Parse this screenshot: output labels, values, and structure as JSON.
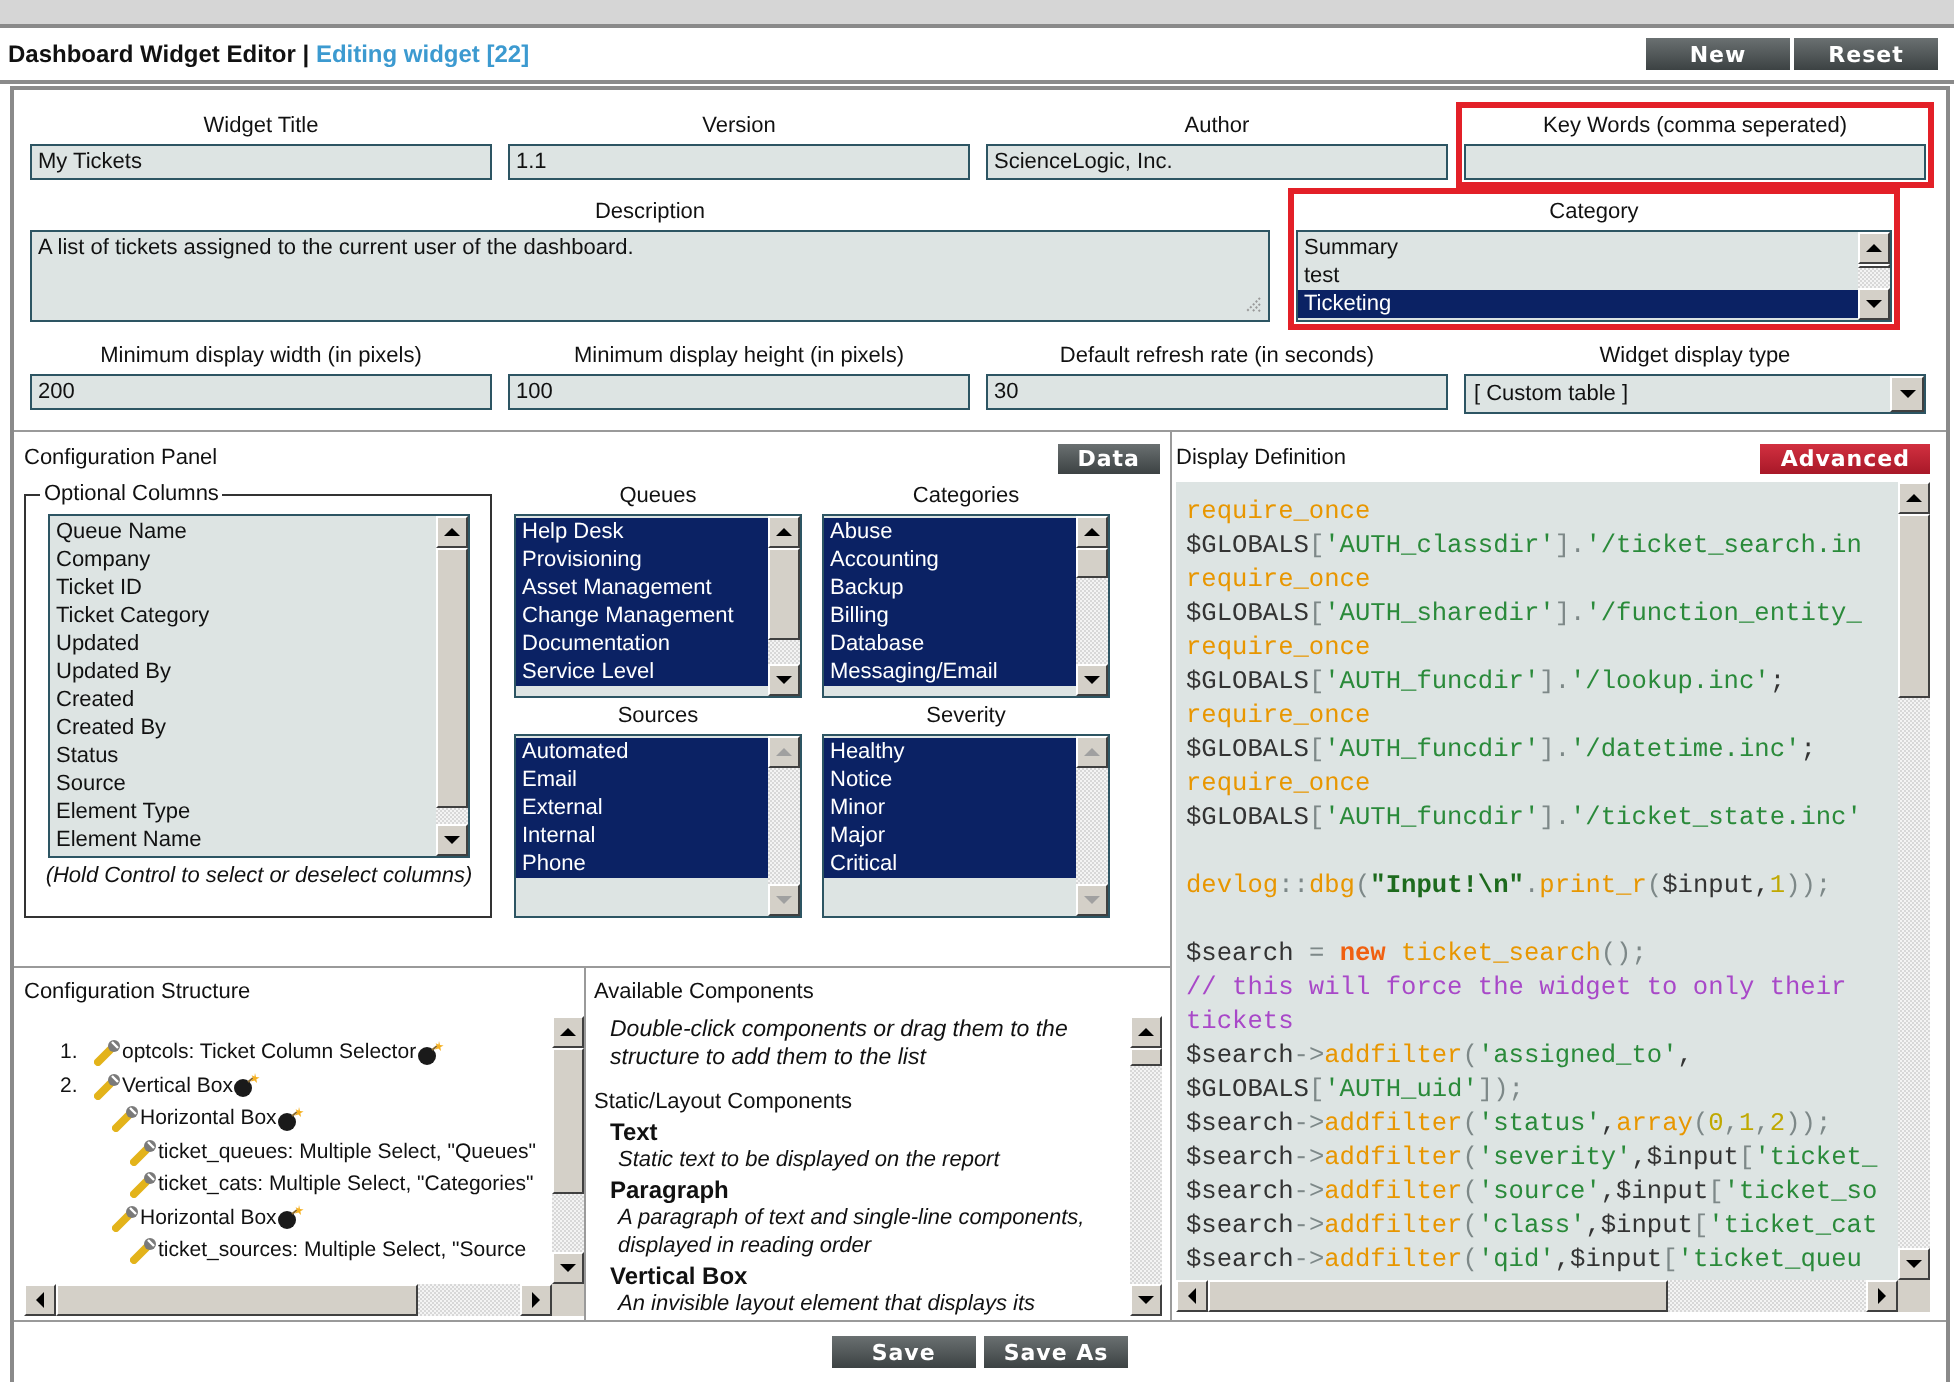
{
  "header": {
    "title": "Dashboard Widget Editor |",
    "subtitle": "Editing widget [22]",
    "buttons": [
      "New",
      "Reset"
    ]
  },
  "form": {
    "row_1": [
      {
        "label": "Widget Title",
        "value": "My Tickets",
        "highlighted": false
      },
      {
        "label": "Version",
        "value": "1.1",
        "highlighted": false
      },
      {
        "label": "Author",
        "value": "ScienceLogic, Inc.",
        "highlighted": false
      },
      {
        "label": "Key Words (comma seperated)",
        "highlighted": true
      }
    ],
    "description": {
      "label": "Description",
      "value": "A list of tickets assigned to the current user of the dashboard.",
      "highlighted": false
    },
    "category": {
      "label": "Category",
      "highlighted": true,
      "options": [
        {
          "label": "Summary",
          "selected": false
        },
        {
          "label": "test",
          "selected": false
        },
        {
          "label": "Ticketing",
          "selected": true
        }
      ]
    },
    "row_3": [
      {
        "label": "Minimum display width (in pixels)",
        "value": "200",
        "kind": "text"
      },
      {
        "label": "Minimum display height (in pixels)",
        "value": "100",
        "kind": "text"
      },
      {
        "label": "Default refresh rate (in seconds)",
        "value": "30",
        "kind": "text"
      },
      {
        "label": "Widget display type",
        "value": "[ Custom table ]",
        "kind": "select"
      }
    ]
  },
  "configuration_panel": {
    "title": "Configuration Panel",
    "data_button": "Data",
    "optional_columns": {
      "legend": "Optional Columns",
      "hint": "(Hold Control to select or deselect columns)",
      "items": [
        {
          "label": "Queue Name",
          "selected": false
        },
        {
          "label": "Company",
          "selected": false
        },
        {
          "label": "Ticket ID",
          "selected": false
        },
        {
          "label": "Ticket Category",
          "selected": false
        },
        {
          "label": "Updated",
          "selected": false
        },
        {
          "label": "Updated By",
          "selected": false
        },
        {
          "label": "Created",
          "selected": false
        },
        {
          "label": "Created By",
          "selected": false
        },
        {
          "label": "Status",
          "selected": false
        },
        {
          "label": "Source",
          "selected": false
        },
        {
          "label": "Element Type",
          "selected": false
        },
        {
          "label": "Element Name",
          "selected": false
        }
      ]
    },
    "lists": [
      {
        "label": "Queues",
        "items": [
          {
            "label": "Help Desk",
            "selected": true
          },
          {
            "label": "Provisioning",
            "selected": true
          },
          {
            "label": "Asset Management",
            "selected": true
          },
          {
            "label": "Change Management",
            "selected": true
          },
          {
            "label": "Documentation",
            "selected": true
          },
          {
            "label": "Service Level",
            "selected": true
          }
        ]
      },
      {
        "label": "Categories",
        "items": [
          {
            "label": "Abuse",
            "selected": true
          },
          {
            "label": "Accounting",
            "selected": true
          },
          {
            "label": "Backup",
            "selected": true
          },
          {
            "label": "Billing",
            "selected": true
          },
          {
            "label": "Database",
            "selected": true
          },
          {
            "label": "Messaging/Email",
            "selected": true
          }
        ]
      },
      {
        "label": "Sources",
        "items": [
          {
            "label": "Automated",
            "selected": true
          },
          {
            "label": "Email",
            "selected": true
          },
          {
            "label": "External",
            "selected": true
          },
          {
            "label": "Internal",
            "selected": true
          },
          {
            "label": "Phone",
            "selected": true
          }
        ]
      },
      {
        "label": "Severity",
        "items": [
          {
            "label": "Healthy",
            "selected": true
          },
          {
            "label": "Notice",
            "selected": true
          },
          {
            "label": "Minor",
            "selected": true
          },
          {
            "label": "Major",
            "selected": true
          },
          {
            "label": "Critical",
            "selected": true
          }
        ]
      }
    ]
  },
  "display_definition": {
    "title": "Display Definition",
    "advanced_button": "Advanced",
    "code": [
      {
        "kind": "code",
        "tokens": [
          {
            "kind": "fn",
            "text": "require_once"
          }
        ]
      },
      {
        "kind": "code",
        "tokens": [
          {
            "kind": "var",
            "text": "$GLOBALS"
          },
          {
            "kind": "op",
            "text": "["
          },
          {
            "kind": "str",
            "text": "'AUTH_classdir'"
          },
          {
            "kind": "op",
            "text": "]."
          },
          {
            "kind": "str",
            "text": "'/ticket_search.in"
          }
        ]
      },
      {
        "kind": "code",
        "tokens": [
          {
            "kind": "fn",
            "text": "require_once"
          }
        ]
      },
      {
        "kind": "code",
        "tokens": [
          {
            "kind": "var",
            "text": "$GLOBALS"
          },
          {
            "kind": "op",
            "text": "["
          },
          {
            "kind": "str",
            "text": "'AUTH_sharedir'"
          },
          {
            "kind": "op",
            "text": "]."
          },
          {
            "kind": "str",
            "text": "'/function_entity_"
          }
        ]
      },
      {
        "kind": "code",
        "tokens": [
          {
            "kind": "fn",
            "text": "require_once"
          }
        ]
      },
      {
        "kind": "code",
        "tokens": [
          {
            "kind": "var",
            "text": "$GLOBALS"
          },
          {
            "kind": "op",
            "text": "["
          },
          {
            "kind": "str",
            "text": "'AUTH_funcdir'"
          },
          {
            "kind": "op",
            "text": "]."
          },
          {
            "kind": "str",
            "text": "'/lookup.inc'"
          },
          {
            "kind": "var",
            "text": ";"
          }
        ]
      },
      {
        "kind": "code",
        "tokens": [
          {
            "kind": "fn",
            "text": "require_once"
          }
        ]
      },
      {
        "kind": "code",
        "tokens": [
          {
            "kind": "var",
            "text": "$GLOBALS"
          },
          {
            "kind": "op",
            "text": "["
          },
          {
            "kind": "str",
            "text": "'AUTH_funcdir'"
          },
          {
            "kind": "op",
            "text": "]."
          },
          {
            "kind": "str",
            "text": "'/datetime.inc'"
          },
          {
            "kind": "var",
            "text": ";"
          }
        ]
      },
      {
        "kind": "code",
        "tokens": [
          {
            "kind": "fn",
            "text": "require_once"
          }
        ]
      },
      {
        "kind": "code",
        "tokens": [
          {
            "kind": "var",
            "text": "$GLOBALS"
          },
          {
            "kind": "op",
            "text": "["
          },
          {
            "kind": "str",
            "text": "'AUTH_funcdir'"
          },
          {
            "kind": "op",
            "text": "]."
          },
          {
            "kind": "str",
            "text": "'/ticket_state.inc'"
          }
        ]
      },
      {
        "kind": "blank"
      },
      {
        "kind": "code",
        "tokens": [
          {
            "kind": "fn",
            "text": "devlog"
          },
          {
            "kind": "op",
            "text": "::"
          },
          {
            "kind": "fn",
            "text": "dbg"
          },
          {
            "kind": "op",
            "text": "("
          },
          {
            "kind": "strong",
            "text": "\"Input!\\n\""
          },
          {
            "kind": "op",
            "text": "."
          },
          {
            "kind": "fn",
            "text": "print_r"
          },
          {
            "kind": "op",
            "text": "("
          },
          {
            "kind": "var",
            "text": "$input,"
          },
          {
            "kind": "num",
            "text": "1"
          },
          {
            "kind": "op",
            "text": "));"
          }
        ]
      },
      {
        "kind": "blank"
      },
      {
        "kind": "code",
        "tokens": [
          {
            "kind": "var",
            "text": "$search"
          },
          {
            "kind": "op",
            "text": " = "
          },
          {
            "kind": "new",
            "text": "new"
          },
          {
            "kind": "fn",
            "text": " ticket_search"
          },
          {
            "kind": "op",
            "text": "();"
          }
        ]
      },
      {
        "kind": "code",
        "tokens": [
          {
            "kind": "comment",
            "text": "// this will force the widget to only their"
          }
        ]
      },
      {
        "kind": "code",
        "tokens": [
          {
            "kind": "comment",
            "text": "tickets"
          }
        ]
      },
      {
        "kind": "code",
        "tokens": [
          {
            "kind": "var",
            "text": "$search"
          },
          {
            "kind": "op",
            "text": "->"
          },
          {
            "kind": "fn",
            "text": "addfilter"
          },
          {
            "kind": "op",
            "text": "("
          },
          {
            "kind": "str",
            "text": "'assigned_to'"
          },
          {
            "kind": "var",
            "text": ","
          }
        ]
      },
      {
        "kind": "code",
        "tokens": [
          {
            "kind": "var",
            "text": "$GLOBALS"
          },
          {
            "kind": "op",
            "text": "["
          },
          {
            "kind": "str",
            "text": "'AUTH_uid'"
          },
          {
            "kind": "op",
            "text": "]);"
          }
        ]
      },
      {
        "kind": "code",
        "tokens": [
          {
            "kind": "var",
            "text": "$search"
          },
          {
            "kind": "op",
            "text": "->"
          },
          {
            "kind": "fn",
            "text": "addfilter"
          },
          {
            "kind": "op",
            "text": "("
          },
          {
            "kind": "str",
            "text": "'status'"
          },
          {
            "kind": "var",
            "text": ","
          },
          {
            "kind": "fn",
            "text": "array"
          },
          {
            "kind": "op",
            "text": "("
          },
          {
            "kind": "num",
            "text": "0"
          },
          {
            "kind": "op",
            "text": ","
          },
          {
            "kind": "num",
            "text": "1"
          },
          {
            "kind": "op",
            "text": ","
          },
          {
            "kind": "num",
            "text": "2"
          },
          {
            "kind": "op",
            "text": "));"
          }
        ]
      },
      {
        "kind": "code",
        "tokens": [
          {
            "kind": "var",
            "text": "$search"
          },
          {
            "kind": "op",
            "text": "->"
          },
          {
            "kind": "fn",
            "text": "addfilter"
          },
          {
            "kind": "op",
            "text": "("
          },
          {
            "kind": "str",
            "text": "'severity'"
          },
          {
            "kind": "var",
            "text": ",$input"
          },
          {
            "kind": "op",
            "text": "["
          },
          {
            "kind": "str",
            "text": "'ticket_"
          }
        ]
      },
      {
        "kind": "code",
        "tokens": [
          {
            "kind": "var",
            "text": "$search"
          },
          {
            "kind": "op",
            "text": "->"
          },
          {
            "kind": "fn",
            "text": "addfilter"
          },
          {
            "kind": "op",
            "text": "("
          },
          {
            "kind": "str",
            "text": "'source'"
          },
          {
            "kind": "var",
            "text": ",$input"
          },
          {
            "kind": "op",
            "text": "["
          },
          {
            "kind": "str",
            "text": "'ticket_so"
          }
        ]
      },
      {
        "kind": "code",
        "tokens": [
          {
            "kind": "var",
            "text": "$search"
          },
          {
            "kind": "op",
            "text": "->"
          },
          {
            "kind": "fn",
            "text": "addfilter"
          },
          {
            "kind": "op",
            "text": "("
          },
          {
            "kind": "str",
            "text": "'class'"
          },
          {
            "kind": "var",
            "text": ",$input"
          },
          {
            "kind": "op",
            "text": "["
          },
          {
            "kind": "str",
            "text": "'ticket_cat"
          }
        ]
      },
      {
        "kind": "code",
        "tokens": [
          {
            "kind": "var",
            "text": "$search"
          },
          {
            "kind": "op",
            "text": "->"
          },
          {
            "kind": "fn",
            "text": "addfilter"
          },
          {
            "kind": "op",
            "text": "("
          },
          {
            "kind": "str",
            "text": "'qid'"
          },
          {
            "kind": "var",
            "text": ",$input"
          },
          {
            "kind": "op",
            "text": "["
          },
          {
            "kind": "str",
            "text": "'ticket_queu"
          }
        ]
      }
    ]
  },
  "configuration_structure": {
    "title": "Configuration Structure",
    "tree": [
      {
        "number": "1.",
        "label": "optcols: Ticket Column Selector",
        "removable": true
      },
      {
        "number": "2.",
        "label": "Vertical Box",
        "removable": true,
        "children": [
          {
            "label": "Horizontal Box",
            "removable": true,
            "children": [
              {
                "label": "ticket_queues: Multiple Select, \"Queues\"",
                "removable": false
              },
              {
                "label": "ticket_cats: Multiple Select, \"Categories\"",
                "removable": false
              }
            ]
          },
          {
            "label": "Horizontal Box",
            "removable": true,
            "children": [
              {
                "label": "ticket_sources: Multiple Select, \"Source",
                "removable": false
              }
            ]
          }
        ]
      }
    ]
  },
  "available_components": {
    "title": "Available Components",
    "hint": "Double-click components or drag them to the structure to add them to the list",
    "sections": [
      {
        "title": "Static/Layout Components",
        "items": [
          {
            "name": "Text",
            "description": "Static text to be displayed on the report"
          },
          {
            "name": "Paragraph",
            "description": "A paragraph of text and single-line components, displayed in reading order"
          },
          {
            "name": "Vertical Box",
            "description": "An invisible layout element that displays its"
          }
        ]
      }
    ]
  },
  "footer": {
    "buttons": [
      "Save",
      "Save As"
    ]
  }
}
